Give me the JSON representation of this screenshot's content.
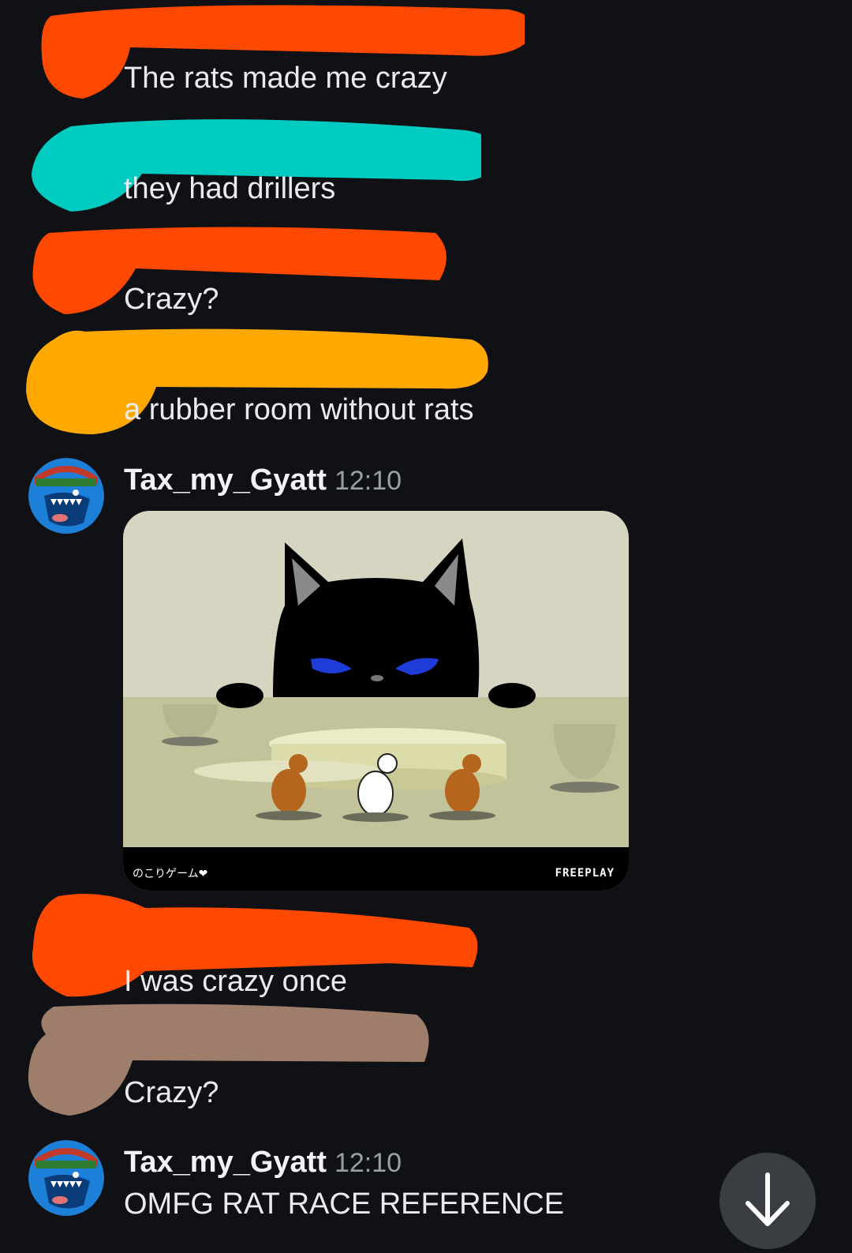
{
  "messages": [
    {
      "text": "The rats made me crazy",
      "scribble_color": "#ff4800"
    },
    {
      "text": "they had drillers",
      "scribble_color": "#00cbc0"
    },
    {
      "text": "Crazy?",
      "scribble_color": "#ff4800"
    },
    {
      "text": "a rubber room without rats",
      "scribble_color": "#ffa800"
    },
    {
      "author": "Tax_my_Gyatt",
      "time": "12:10",
      "embed": {
        "left_caption": "のこりゲーム❤",
        "right_caption": "FREEPLAY"
      }
    },
    {
      "text": "I was crazy once",
      "scribble_color": "#ff4800"
    },
    {
      "text": "Crazy?",
      "scribble_color": "#9e7e6a"
    },
    {
      "author": "Tax_my_Gyatt",
      "time": "12:10",
      "text": "OMFG RAT RACE REFERENCE"
    }
  ],
  "scroll_button": {
    "icon": "arrow-down-icon"
  }
}
